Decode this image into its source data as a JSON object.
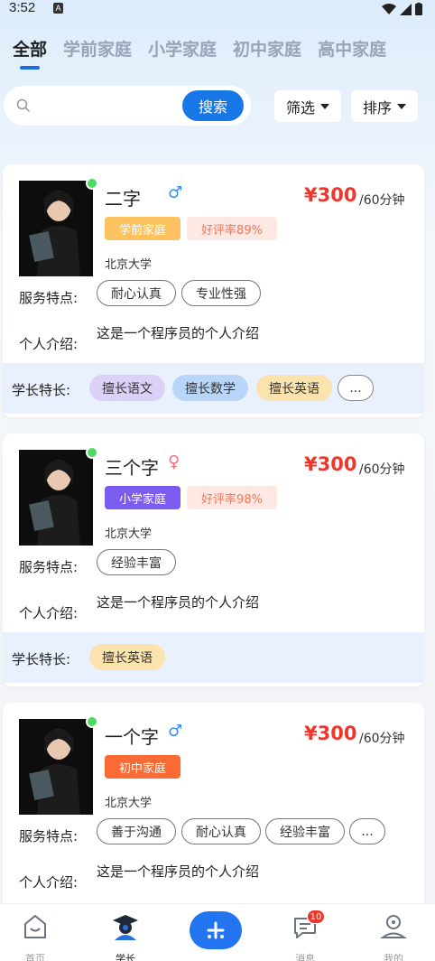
{
  "status": {
    "time": "3:52",
    "notif": "A"
  },
  "tabs": [
    "全部",
    "学前家庭",
    "小学家庭",
    "初中家庭",
    "高中家庭"
  ],
  "search": {
    "placeholder": "",
    "button": "搜索"
  },
  "filter_label": "筛选",
  "sort_label": "排序",
  "labels": {
    "service": "服务特点:",
    "intro": "个人介绍:",
    "strength": "学长特长:"
  },
  "cards": [
    {
      "name": "二字",
      "gender": "♂",
      "price": "¥300",
      "duration": "/60分钟",
      "level_tag": "学前家庭",
      "rating": "好评率89%",
      "school": "北京大学",
      "features": [
        "耐心认真",
        "专业性强"
      ],
      "intro": "这是一个程序员的个人介绍",
      "skills": [
        "擅长语文",
        "擅长数学",
        "擅长英语",
        "..."
      ]
    },
    {
      "name": "三个字",
      "gender": "♀",
      "price": "¥300",
      "duration": "/60分钟",
      "level_tag": "小学家庭",
      "rating": "好评率98%",
      "school": "北京大学",
      "features": [
        "经验丰富"
      ],
      "intro": "这是一个程序员的个人介绍",
      "skills": [
        "擅长英语"
      ]
    },
    {
      "name": "一个字",
      "gender": "♂",
      "price": "¥300",
      "duration": "/60分钟",
      "level_tag": "初中家庭",
      "school": "北京大学",
      "features": [
        "善于沟通",
        "耐心认真",
        "经验丰富",
        "..."
      ],
      "intro": "这是一个程序员的个人介绍"
    }
  ],
  "nav": [
    {
      "label": "首页"
    },
    {
      "label": "学长"
    },
    {
      "label": ""
    },
    {
      "label": "消息",
      "badge": "10"
    },
    {
      "label": "我的"
    }
  ],
  "colors": {
    "accent": "#1877e6",
    "price": "#f0362a",
    "preschool": "#fbc25f",
    "primary": "#7c5cf0",
    "middle": "#fa6a34"
  }
}
